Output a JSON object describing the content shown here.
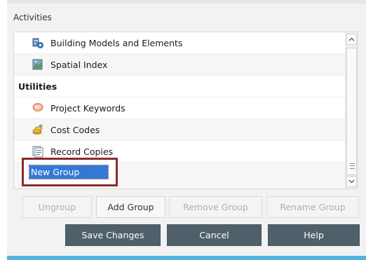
{
  "panel": {
    "title": "Activities"
  },
  "list": {
    "rows": [
      {
        "kind": "item",
        "label": "Building Models and Elements",
        "icon": "building-models-icon"
      },
      {
        "kind": "item",
        "label": "Spatial Index",
        "icon": "spatial-index-icon"
      },
      {
        "kind": "group",
        "label": "Utilities"
      },
      {
        "kind": "item",
        "label": "Project Keywords",
        "icon": "project-keywords-icon"
      },
      {
        "kind": "item",
        "label": "Cost Codes",
        "icon": "cost-codes-icon"
      },
      {
        "kind": "item",
        "label": "Record Copies",
        "icon": "record-copies-icon"
      }
    ],
    "edit_value": "New Group"
  },
  "group_buttons": {
    "ungroup": "Ungroup",
    "add_group": "Add Group",
    "remove_group": "Remove Group",
    "rename_group": "Rename Group"
  },
  "footer_buttons": {
    "save_changes": "Save Changes",
    "cancel": "Cancel",
    "help": "Help"
  },
  "colors": {
    "accent_bar": "#55b4dc",
    "edit_highlight_border": "#8b2a2a",
    "selection": "#3478d6",
    "dark_button": "#50606b"
  }
}
